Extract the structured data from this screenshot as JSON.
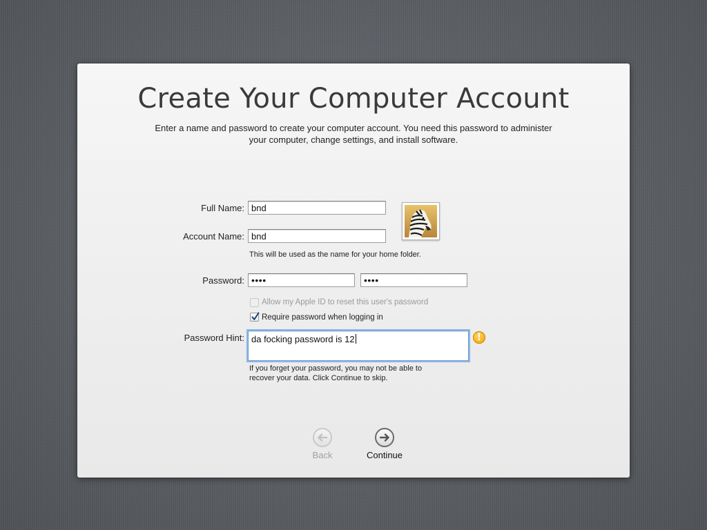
{
  "window": {
    "title": "Create Your Computer Account",
    "subtitle": "Enter a name and password to create your computer account. You need this password to administer your computer, change settings, and install software."
  },
  "form": {
    "full_name_label": "Full Name:",
    "full_name_value": "bnd",
    "account_name_label": "Account Name:",
    "account_name_value": "bnd",
    "account_name_note": "This will be used as the name for your home folder.",
    "password_label": "Password:",
    "password_value": "••••",
    "verify_value": "••••",
    "apple_id_reset_label": "Allow my Apple ID to reset this user's password",
    "apple_id_reset_checked": false,
    "apple_id_reset_enabled": false,
    "require_password_label": "Require password when logging in",
    "require_password_checked": true,
    "hint_label": "Password Hint:",
    "hint_value": "da focking password is 12",
    "hint_warning_icon": "warning-icon",
    "hint_note_line1": "If you forget your password, you may not be able to",
    "hint_note_line2": "recover your data. Click Continue to skip."
  },
  "avatar": {
    "icon": "zebra-user-picture"
  },
  "nav": {
    "back_label": "Back",
    "back_enabled": false,
    "continue_label": "Continue"
  },
  "colors": {
    "accent_focus": "#8db7e5",
    "warning": "#f2a500",
    "background": "#5d6066"
  }
}
